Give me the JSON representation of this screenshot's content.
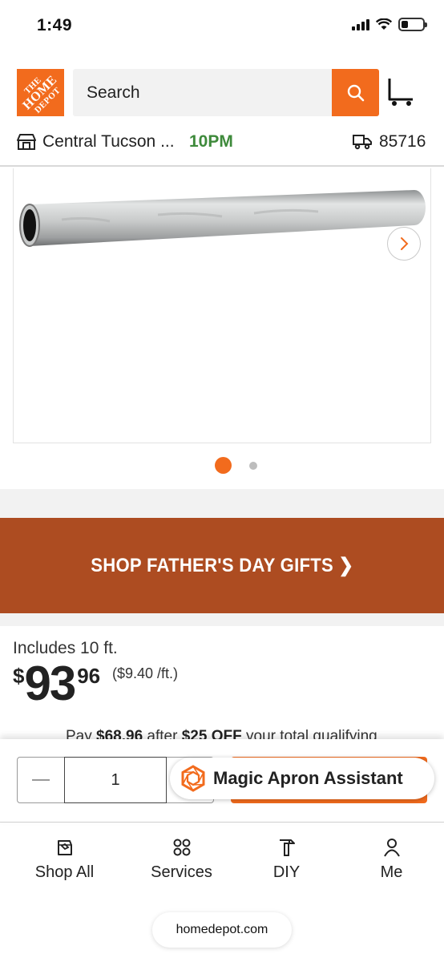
{
  "status_bar": {
    "time": "1:49",
    "battery_level": 0.3,
    "icons": [
      "signal-icon",
      "wifi-icon",
      "battery-icon"
    ]
  },
  "header": {
    "logo_text_line1": "THE",
    "logo_text_line2": "HOME",
    "logo_text_line3": "DEPOT",
    "search_placeholder": "Search",
    "icons": [
      "search-icon",
      "cart-icon"
    ]
  },
  "store": {
    "name": "Central Tucson ...",
    "hours": "10PM",
    "zip": "85716",
    "icons": [
      "store-icon",
      "delivery-truck-icon"
    ]
  },
  "gallery": {
    "active_index": 0,
    "count": 2,
    "icons": [
      "chevron-right-icon"
    ]
  },
  "promo": {
    "label": "SHOP FATHER'S DAY GIFTS ❯"
  },
  "product": {
    "includes": "Includes 10 ft.",
    "price_dollar": "$",
    "price_whole": "93",
    "price_cents": "96",
    "unit_price": "($9.40 /ft.)",
    "pay_prefix": "Pay ",
    "pay_amount": "$68.96",
    "pay_middle": " after ",
    "pay_discount": "$25 OFF",
    "pay_suffix": " your total qualifying"
  },
  "buy_bar": {
    "quantity": "1",
    "assistant_label": "Magic Apron Assistant",
    "icons": [
      "minus-icon",
      "magic-apron-icon"
    ]
  },
  "bottom_nav": {
    "items": [
      {
        "label": "Shop All",
        "icon": "shop-all-icon"
      },
      {
        "label": "Services",
        "icon": "services-icon"
      },
      {
        "label": "DIY",
        "icon": "diy-hammer-icon"
      },
      {
        "label": "Me",
        "icon": "me-icon"
      }
    ]
  },
  "browser": {
    "url": "homedepot.com"
  },
  "colors": {
    "brand_orange": "#f26b1d",
    "promo_brown": "#ad4c21",
    "hours_green": "#3e8a3b"
  }
}
